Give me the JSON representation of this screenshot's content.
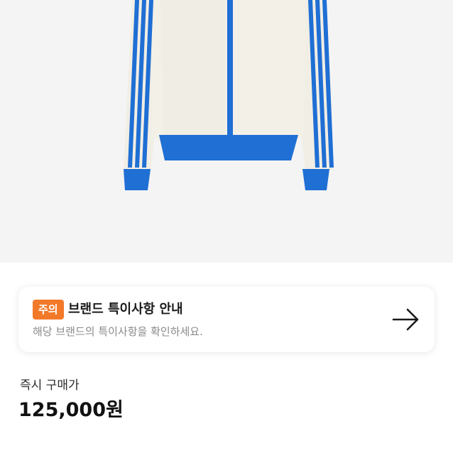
{
  "colors": {
    "image_background": "#f4f4f4",
    "jacket_body": "#f1eee5",
    "jacket_stripe_blue": "#1f6fd4",
    "notice_badge_bg": "#f3792a",
    "notice_desc_text": "#8a8a8a"
  },
  "product": {
    "image_icon": "track-jacket-image"
  },
  "notice": {
    "badge": "주의",
    "title": "브랜드 특이사항 안내",
    "description": "해당 브랜드의 특이사항을 확인하세요.",
    "arrow_icon": "arrow-right-icon"
  },
  "price": {
    "label": "즉시 구매가",
    "value": "125,000원"
  }
}
